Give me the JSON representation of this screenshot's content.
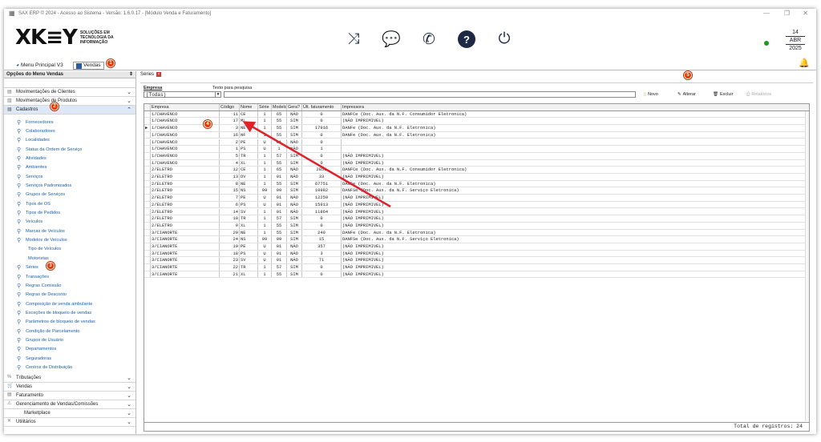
{
  "titlebar": {
    "title": "SAX ERP © 2024 - Acesso ao Sistema - Versão: 1.6.0.17 - [Módulo Venda e Faturamento]"
  },
  "logo": {
    "text": "XK≡Y",
    "tagline": "SOLUÇÕES EM TECNOLOGIA DA INFORMAÇÃO"
  },
  "date": {
    "day": "14",
    "month": "ABR",
    "year": "2025"
  },
  "tabs": [
    {
      "label": "Menu Principal V3"
    },
    {
      "label": "Vendas"
    }
  ],
  "sidebar": {
    "title": "Opções do Menu Vendas",
    "top_groups": [
      "Movimentações de Clientes",
      "Movimentações de Produtos",
      "Cadastros"
    ],
    "items": [
      "Fornecedores",
      "Colaboradores",
      "Localidades",
      "Status da Ordem de Serviço",
      "Atividades",
      "Ambientes",
      "Serviços",
      "Serviços Padronizados",
      "Grupos de Serviços",
      "Tipos de OS",
      "Tipos de Pedidos",
      "Veículos",
      "Marcas de Veículos",
      "Modelos de Veículos",
      "Tipo de Veículos",
      "Motoristas",
      "Séries",
      "Transações",
      "Regras Comissão",
      "Regras de Desconto",
      "Composição de venda ambulante",
      "Exceções de bloqueio de vendas",
      "Parâmetros de bloqueio de vendas",
      "Condição de Parcelamento",
      "Grupos de Usuário",
      "Departamentos",
      "Seguradoras",
      "Centros de Distribuição"
    ],
    "bottom_groups": [
      "Tributações",
      "Vendas",
      "Faturamento",
      "Gerenciamento de Vendas/Comissões",
      "Marketplace",
      "Utilitários"
    ]
  },
  "content": {
    "tab_label": "Séries",
    "filter": {
      "empresa_label": "Empresa",
      "search_label": "Texto para pesquisa",
      "empresa_value": "(Todas)"
    },
    "buttons": {
      "novo": "Novo",
      "alterar": "Alterar",
      "excluir": "Excluir",
      "relatorios": "Relatórios"
    },
    "columns": [
      "Empresa",
      "Código",
      "Nome",
      "Série",
      "Modelo",
      "Gera?",
      "Últ. faturamento",
      "Impressora"
    ],
    "rows": [
      [
        "1/CHAVENCO",
        "11",
        "CE",
        "1",
        "65",
        "NÃO",
        "0",
        "DANFCe (Doc. Aux. da N.F. Consumidor Eletronica)"
      ],
      [
        "1/CHAVENCO",
        "17",
        "ML",
        "1",
        "55",
        "SIM",
        "0",
        "(NÃO IMPRIMIVEL)"
      ],
      [
        "1/CHAVENCO",
        "3",
        "NE",
        "1",
        "55",
        "SIM",
        "17916",
        "DANFe (Doc. Aux. da N.F. Eletronica)"
      ],
      [
        "1/CHAVENCO",
        "16",
        "NF",
        "1",
        "55",
        "SIM",
        "0",
        "DANFe (Doc. Aux. da N.F. Eletronica)"
      ],
      [
        "1/CHAVENCO",
        "2",
        "PE",
        "U",
        "01",
        "NÃO",
        "0",
        ""
      ],
      [
        "1/CHAVENCO",
        "1",
        "PS",
        "U",
        "1",
        "NÃO",
        "1",
        ""
      ],
      [
        "1/CHAVENCO",
        "5",
        "TR",
        "1",
        "57",
        "SIM",
        "0",
        "(NÃO IMPRIMIVEL)"
      ],
      [
        "1/CHAVENCO",
        "4",
        "XL",
        "1",
        "55",
        "SIM",
        "0",
        "(NÃO IMPRIMIVEL)"
      ],
      [
        "2/ELETRO",
        "12",
        "CE",
        "1",
        "65",
        "NÃO",
        "2855",
        "DANFCe (Doc. Aux. da N.F. Consumidor Eletronica)"
      ],
      [
        "2/ELETRO",
        "13",
        "DV",
        "1",
        "01",
        "NÃO",
        "33",
        "(NÃO IMPRIMIVEL)"
      ],
      [
        "2/ELETRO",
        "8",
        "NE",
        "1",
        "55",
        "SIM",
        "67751",
        "DANFe (Doc. Aux. da N.F. Eletronica)"
      ],
      [
        "2/ELETRO",
        "15",
        "NS",
        "99",
        "99",
        "SIM",
        "10982",
        "DANFSe (Doc. Aux. da N.F. Serviço Eletronica)"
      ],
      [
        "2/ELETRO",
        "7",
        "PE",
        "U",
        "01",
        "NÃO",
        "12259",
        "(NÃO IMPRIMIVEL)"
      ],
      [
        "2/ELETRO",
        "6",
        "PS",
        "U",
        "01",
        "NÃO",
        "15913",
        "(NÃO IMPRIMIVEL)"
      ],
      [
        "2/ELETRO",
        "14",
        "SV",
        "1",
        "01",
        "NÃO",
        "11864",
        "(NÃO IMPRIMIVEL)"
      ],
      [
        "2/ELETRO",
        "10",
        "TR",
        "1",
        "57",
        "SIM",
        "0",
        "(NÃO IMPRIMIVEL)"
      ],
      [
        "2/ELETRO",
        "9",
        "XL",
        "1",
        "55",
        "SIM",
        "0",
        "(NÃO IMPRIMIVEL)"
      ],
      [
        "3/CIANORTE",
        "20",
        "NE",
        "1",
        "55",
        "SIM",
        "249",
        "DANFe (Doc. Aux. da N.F. Eletronica)"
      ],
      [
        "3/CIANORTE",
        "24",
        "NS",
        "99",
        "99",
        "SIM",
        "15",
        "DANFSe (Doc. Aux. da N.F. Serviço Eletronica)"
      ],
      [
        "3/CIANORTE",
        "19",
        "PE",
        "U",
        "01",
        "NÃO",
        "357",
        "(NÃO IMPRIMIVEL)"
      ],
      [
        "3/CIANORTE",
        "18",
        "PS",
        "U",
        "01",
        "NÃO",
        "3",
        "(NÃO IMPRIMIVEL)"
      ],
      [
        "3/CIANORTE",
        "23",
        "SV",
        "U",
        "01",
        "NÃO",
        "71",
        "(NÃO IMPRIMIVEL)"
      ],
      [
        "3/CIANORTE",
        "22",
        "TR",
        "1",
        "57",
        "SIM",
        "0",
        "(NÃO IMPRIMIVEL)"
      ],
      [
        "3/CIANORTE",
        "21",
        "XL",
        "1",
        "55",
        "SIM",
        "0",
        "(NÃO IMPRIMIVEL)"
      ]
    ],
    "total": "Total de registros: 24"
  },
  "badges": [
    "1",
    "2",
    "3",
    "4",
    "5"
  ],
  "colors": {
    "badge": "#e53900",
    "arrow": "#e0202a",
    "brand": "#1e2a44",
    "status_online": "#1a9c1a"
  }
}
